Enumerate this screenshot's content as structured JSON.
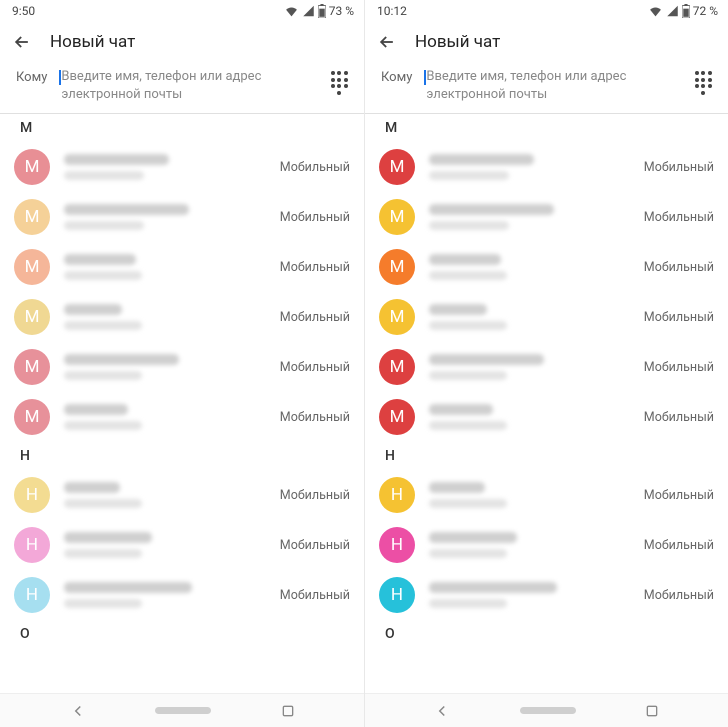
{
  "panes": [
    {
      "status": {
        "time": "9:50",
        "battery": "73 %"
      },
      "header": {
        "title": "Новый чат"
      },
      "to": {
        "label": "Кому",
        "placeholder": "Введите имя, телефон или адрес электронной почты"
      },
      "sections": [
        {
          "letter": "M",
          "contacts": [
            {
              "initial": "M",
              "color": "#e88f95",
              "nameW": 105,
              "subW": 80,
              "type": "Мобильный"
            },
            {
              "initial": "M",
              "color": "#f5d198",
              "nameW": 125,
              "subW": 80,
              "type": "Мобильный"
            },
            {
              "initial": "M",
              "color": "#f5b699",
              "nameW": 72,
              "subW": 78,
              "type": "Мобильный"
            },
            {
              "initial": "M",
              "color": "#f0d893",
              "nameW": 58,
              "subW": 78,
              "type": "Мобильный"
            },
            {
              "initial": "M",
              "color": "#e7919a",
              "nameW": 115,
              "subW": 78,
              "type": "Мобильный"
            },
            {
              "initial": "M",
              "color": "#e7919a",
              "nameW": 64,
              "subW": 78,
              "type": "Мобильный"
            }
          ]
        },
        {
          "letter": "Н",
          "contacts": [
            {
              "initial": "H",
              "color": "#f3dc92",
              "nameW": 56,
              "subW": 78,
              "type": "Мобильный"
            },
            {
              "initial": "H",
              "color": "#f3a8d8",
              "nameW": 88,
              "subW": 78,
              "type": "Мобильный"
            },
            {
              "initial": "H",
              "color": "#a6dff0",
              "nameW": 128,
              "subW": 78,
              "type": "Мобильный"
            }
          ]
        },
        {
          "letter": "О",
          "contacts": []
        }
      ]
    },
    {
      "status": {
        "time": "10:12",
        "battery": "72 %"
      },
      "header": {
        "title": "Новый чат"
      },
      "to": {
        "label": "Кому",
        "placeholder": "Введите имя, телефон или адрес электронной почты"
      },
      "sections": [
        {
          "letter": "M",
          "contacts": [
            {
              "initial": "M",
              "color": "#dd4040",
              "nameW": 105,
              "subW": 80,
              "type": "Мобильный"
            },
            {
              "initial": "M",
              "color": "#f5c232",
              "nameW": 125,
              "subW": 80,
              "type": "Мобильный"
            },
            {
              "initial": "M",
              "color": "#f57c2b",
              "nameW": 72,
              "subW": 78,
              "type": "Мобильный"
            },
            {
              "initial": "M",
              "color": "#f5c232",
              "nameW": 58,
              "subW": 78,
              "type": "Мобильный"
            },
            {
              "initial": "M",
              "color": "#dd4040",
              "nameW": 115,
              "subW": 78,
              "type": "Мобильный"
            },
            {
              "initial": "M",
              "color": "#dd4040",
              "nameW": 64,
              "subW": 78,
              "type": "Мобильный"
            }
          ]
        },
        {
          "letter": "Н",
          "contacts": [
            {
              "initial": "H",
              "color": "#f5c232",
              "nameW": 56,
              "subW": 78,
              "type": "Мобильный"
            },
            {
              "initial": "H",
              "color": "#ec4fa5",
              "nameW": 88,
              "subW": 78,
              "type": "Мобильный"
            },
            {
              "initial": "H",
              "color": "#26c1da",
              "nameW": 128,
              "subW": 78,
              "type": "Мобильный"
            }
          ]
        },
        {
          "letter": "О",
          "contacts": []
        }
      ]
    }
  ]
}
